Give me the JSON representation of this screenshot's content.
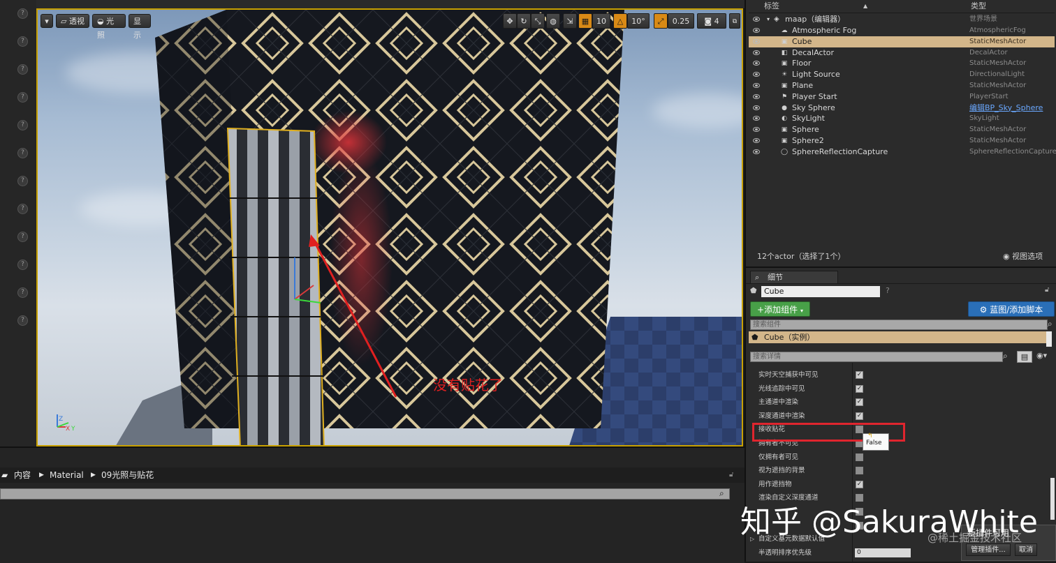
{
  "viewport": {
    "toolbar": {
      "perspective": "透视",
      "lit": "光照",
      "show": "显示",
      "grid_snap": "10",
      "rotate_snap": "10°",
      "scale_snap": "0.25",
      "camera_speed": "4"
    },
    "annotation": "没有贴花了"
  },
  "content_browser": {
    "breadcrumbs": [
      "内容",
      "Material",
      "09光照与贴花"
    ]
  },
  "outliner": {
    "col_label": "标签",
    "col_type": "类型",
    "world": {
      "name": "maap（编辑器）",
      "type": "世界场景"
    },
    "actors": [
      {
        "name": "Atmospheric Fog",
        "type": "AtmosphericFog",
        "icon": "fog-icon"
      },
      {
        "name": "Cube",
        "type": "StaticMeshActor",
        "icon": "mesh-icon",
        "selected": true
      },
      {
        "name": "DecalActor",
        "type": "DecalActor",
        "icon": "decal-icon"
      },
      {
        "name": "Floor",
        "type": "StaticMeshActor",
        "icon": "mesh-icon"
      },
      {
        "name": "Light Source",
        "type": "DirectionalLight",
        "icon": "light-icon"
      },
      {
        "name": "Plane",
        "type": "StaticMeshActor",
        "icon": "mesh-icon"
      },
      {
        "name": "Player Start",
        "type": "PlayerStart",
        "icon": "player-start-icon"
      },
      {
        "name": "Sky Sphere",
        "type": "编辑BP_Sky_Sphere",
        "icon": "sphere-icon",
        "link": true
      },
      {
        "name": "SkyLight",
        "type": "SkyLight",
        "icon": "skylight-icon"
      },
      {
        "name": "Sphere",
        "type": "StaticMeshActor",
        "icon": "mesh-icon"
      },
      {
        "name": "Sphere2",
        "type": "StaticMeshActor",
        "icon": "mesh-icon"
      },
      {
        "name": "SphereReflectionCapture",
        "type": "SphereReflectionCapture",
        "icon": "capture-icon"
      }
    ],
    "footer_count": "12个actor（选择了1个）",
    "view_options": "视图选项"
  },
  "details": {
    "tab": "细节",
    "actor_name": "Cube",
    "add_component": "+添加组件",
    "blueprint": "蓝图/添加脚本",
    "search_components": "搜索组件",
    "component_root": "Cube（实例）",
    "search_details": "搜索详情",
    "properties": [
      {
        "label": "实时天空捕获中可见",
        "checked": true
      },
      {
        "label": "光线追踪中可见",
        "checked": true
      },
      {
        "label": "主通道中渲染",
        "checked": true
      },
      {
        "label": "深度通道中渲染",
        "checked": true
      },
      {
        "label": "接收贴花",
        "checked": false
      },
      {
        "label": "拥有者不可见",
        "checked": false
      },
      {
        "label": "仅拥有者可见",
        "checked": false
      },
      {
        "label": "视为遮挡的背景",
        "checked": false
      },
      {
        "label": "用作遮挡物",
        "checked": true
      },
      {
        "label": "渲染自定义深度通道",
        "checked": false
      },
      {
        "label": "",
        "checked": false
      },
      {
        "label": "",
        "checked": false
      },
      {
        "label": "自定义基元数据默认值",
        "checked": null
      },
      {
        "label": "半透明排序优先级",
        "checked": null,
        "value": "0"
      }
    ],
    "tooltip_value": "False"
  },
  "plugin_popup": {
    "title": "新插件可用",
    "manage": "管理插件...",
    "cancel": "取消"
  },
  "watermark": {
    "main": "知乎 @SakuraWhite",
    "secondary": "@稀土掘金技术社区"
  },
  "colors": {
    "selection": "#d3b68a",
    "accent_orange": "#d98a16",
    "add_green": "#48a048",
    "blueprint_blue": "#2a6fb8",
    "highlight_red": "#e0252e"
  }
}
